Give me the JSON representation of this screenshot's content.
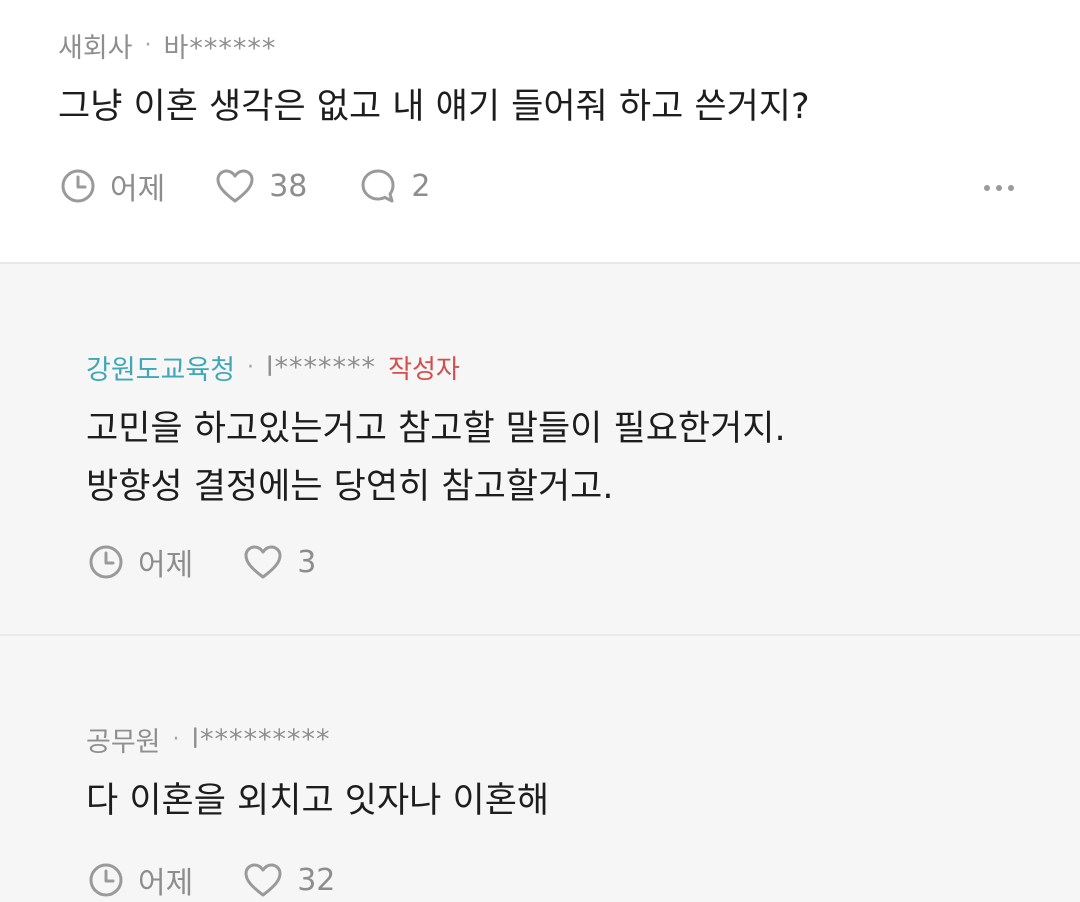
{
  "comments": [
    {
      "company": "새회사",
      "separator": "·",
      "user": "바******",
      "lines": [
        "그냥 이혼 생각은 없고 내 얘기 들어줘 하고 쓴거지?"
      ],
      "time": "어제",
      "likes": "38",
      "replies": "2"
    }
  ],
  "replies": [
    {
      "company": "강원도교육청",
      "separator": "·",
      "user": "l*******",
      "author_badge": "작성자",
      "lines": [
        "고민을 하고있는거고 참고할 말들이 필요한거지.",
        "방향성 결정에는 당연히 참고할거고."
      ],
      "time": "어제",
      "likes": "3"
    },
    {
      "company": "공무원",
      "separator": "·",
      "user": "l*********",
      "lines": [
        "다 이혼을 외치고 잇자나 이혼해"
      ],
      "time": "어제",
      "likes": "32"
    }
  ],
  "icons": {
    "clock": "clock-icon",
    "heart": "heart-icon",
    "comment": "comment-icon",
    "more": "more-icon"
  },
  "colors": {
    "accent_company": "#3fa7b6",
    "author_badge": "#d14f4f",
    "reply_bg": "#f6f6f6",
    "meta_text": "#8f8f8f"
  }
}
